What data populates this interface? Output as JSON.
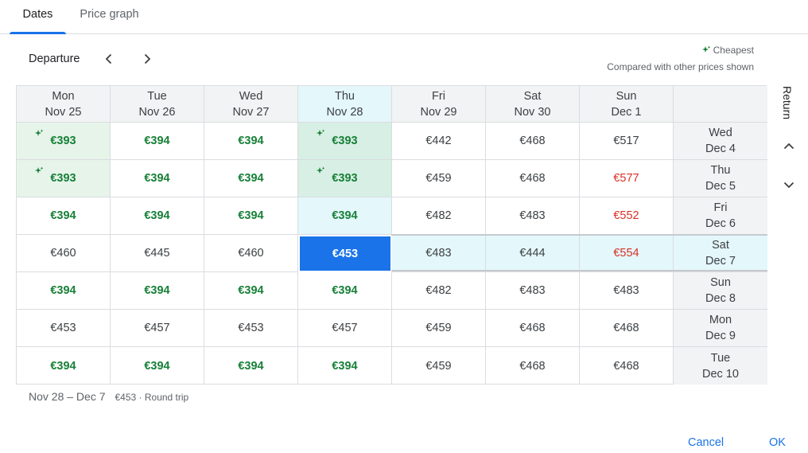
{
  "tabs": [
    {
      "label": "Dates"
    },
    {
      "label": "Price graph"
    }
  ],
  "departure": {
    "label": "Departure"
  },
  "legend": {
    "cheapest": "Cheapest",
    "compared": "Compared with other prices shown"
  },
  "return_label": "Return",
  "columns": [
    {
      "day": "Mon",
      "date": "Nov 25"
    },
    {
      "day": "Tue",
      "date": "Nov 26"
    },
    {
      "day": "Wed",
      "date": "Nov 27"
    },
    {
      "day": "Thu",
      "date": "Nov 28"
    },
    {
      "day": "Fri",
      "date": "Nov 29"
    },
    {
      "day": "Sat",
      "date": "Nov 30"
    },
    {
      "day": "Sun",
      "date": "Dec 1"
    }
  ],
  "rows": [
    {
      "day": "Wed",
      "date": "Dec 4",
      "prices": [
        "€393",
        "€394",
        "€394",
        "€393",
        "€442",
        "€468",
        "€517"
      ]
    },
    {
      "day": "Thu",
      "date": "Dec 5",
      "prices": [
        "€393",
        "€394",
        "€394",
        "€393",
        "€459",
        "€468",
        "€577"
      ]
    },
    {
      "day": "Fri",
      "date": "Dec 6",
      "prices": [
        "€394",
        "€394",
        "€394",
        "€394",
        "€482",
        "€483",
        "€552"
      ]
    },
    {
      "day": "Sat",
      "date": "Dec 7",
      "prices": [
        "€460",
        "€445",
        "€460",
        "€453",
        "€483",
        "€444",
        "€554"
      ]
    },
    {
      "day": "Sun",
      "date": "Dec 8",
      "prices": [
        "€394",
        "€394",
        "€394",
        "€394",
        "€482",
        "€483",
        "€483"
      ]
    },
    {
      "day": "Mon",
      "date": "Dec 9",
      "prices": [
        "€453",
        "€457",
        "€453",
        "€457",
        "€459",
        "€468",
        "€468"
      ]
    },
    {
      "day": "Tue",
      "date": "Dec 10",
      "prices": [
        "€394",
        "€394",
        "€394",
        "€394",
        "€459",
        "€468",
        "€468"
      ]
    }
  ],
  "summary": {
    "dates": "Nov 28 – Dec 7",
    "price": "€453 · Round trip"
  },
  "buttons": {
    "cancel": "Cancel",
    "ok": "OK"
  },
  "colors": {
    "accent": "#1a73e8",
    "cheap": "#188038",
    "expensive": "#d93025"
  }
}
